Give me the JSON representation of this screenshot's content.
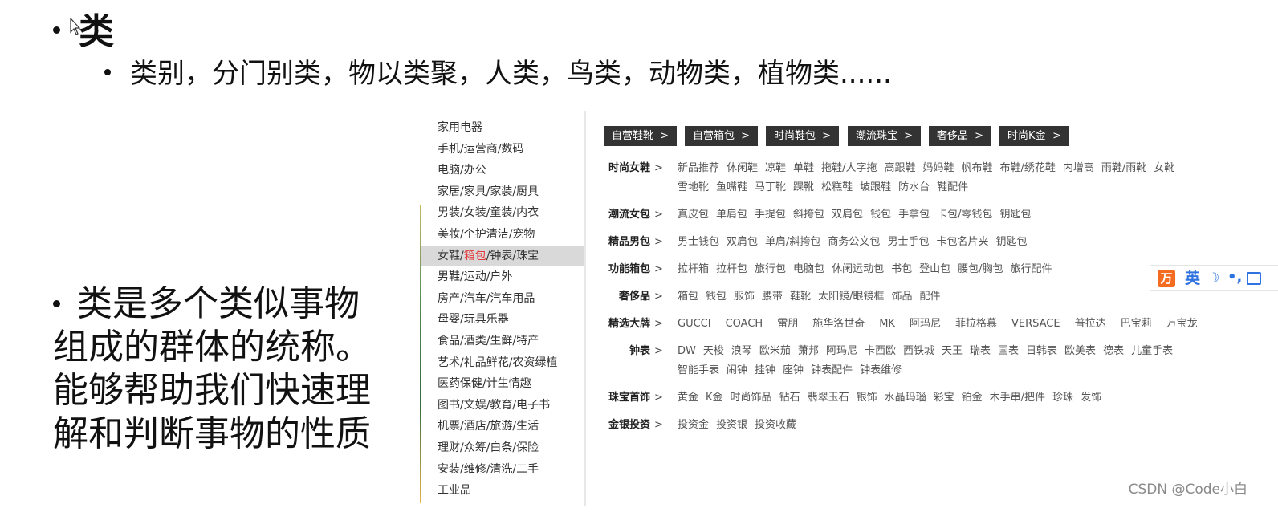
{
  "slide": {
    "title": "类",
    "subtitle": "类别，分门别类，物以类聚，人类，鸟类，动物类，植物类......",
    "definition_lines": [
      "类是多个类似事物",
      "组成的群体的统称。",
      "能够帮助我们快速理",
      "解和判断事物的性质"
    ]
  },
  "sidebar": {
    "items": [
      {
        "label": "家用电器"
      },
      {
        "label": "手机/运营商/数码"
      },
      {
        "label": "电脑/办公"
      },
      {
        "label": "家居/家具/家装/厨具"
      },
      {
        "label": "男装/女装/童装/内衣"
      },
      {
        "label": "美妆/个护清洁/宠物"
      },
      {
        "label_pre": "女鞋/",
        "label_hl": "箱包",
        "label_post": "/钟表/珠宝",
        "active": true
      },
      {
        "label": "男鞋/运动/户外"
      },
      {
        "label": "房产/汽车/汽车用品"
      },
      {
        "label": "母婴/玩具乐器"
      },
      {
        "label": "食品/酒类/生鲜/特产"
      },
      {
        "label": "艺术/礼品鲜花/农资绿植"
      },
      {
        "label": "医药保健/计生情趣"
      },
      {
        "label": "图书/文娱/教育/电子书"
      },
      {
        "label": "机票/酒店/旅游/生活"
      },
      {
        "label": "理财/众筹/白条/保险"
      },
      {
        "label": "安装/维修/清洗/二手"
      },
      {
        "label": "工业品"
      }
    ],
    "highlight_color": "#e4393c"
  },
  "tags": [
    {
      "label": "自营鞋靴"
    },
    {
      "label": "自营箱包"
    },
    {
      "label": "时尚鞋包"
    },
    {
      "label": "潮流珠宝"
    },
    {
      "label": "奢侈品"
    },
    {
      "label": "时尚K金"
    }
  ],
  "chevron": ">",
  "categories": [
    {
      "name": "时尚女鞋",
      "rows": [
        [
          "新品推荐",
          "休闲鞋",
          "凉鞋",
          "单鞋",
          "拖鞋/人字拖",
          "高跟鞋",
          "妈妈鞋",
          "帆布鞋",
          "布鞋/绣花鞋",
          "内增高",
          "雨鞋/雨靴",
          "女靴"
        ],
        [
          "雪地靴",
          "鱼嘴鞋",
          "马丁靴",
          "踝靴",
          "松糕鞋",
          "坡跟鞋",
          "防水台",
          "鞋配件"
        ]
      ]
    },
    {
      "name": "潮流女包",
      "rows": [
        [
          "真皮包",
          "单肩包",
          "手提包",
          "斜挎包",
          "双肩包",
          "钱包",
          "手拿包",
          "卡包/零钱包",
          "钥匙包"
        ]
      ]
    },
    {
      "name": "精品男包",
      "rows": [
        [
          "男士钱包",
          "双肩包",
          "单肩/斜挎包",
          "商务公文包",
          "男士手包",
          "卡包名片夹",
          "钥匙包"
        ]
      ]
    },
    {
      "name": "功能箱包",
      "rows": [
        [
          "拉杆箱",
          "拉杆包",
          "旅行包",
          "电脑包",
          "休闲运动包",
          "书包",
          "登山包",
          "腰包/胸包",
          "旅行配件"
        ]
      ]
    },
    {
      "name": "奢侈品",
      "rows": [
        [
          "箱包",
          "钱包",
          "服饰",
          "腰带",
          "鞋靴",
          "太阳镜/眼镜框",
          "饰品",
          "配件"
        ]
      ]
    },
    {
      "name": "精选大牌",
      "wide": true,
      "rows": [
        [
          "GUCCI",
          "COACH",
          "雷朋",
          "施华洛世奇",
          "MK",
          "阿玛尼",
          "菲拉格慕",
          "VERSACE",
          "普拉达",
          "巴宝莉",
          "万宝龙"
        ]
      ]
    },
    {
      "name": "钟表",
      "rows": [
        [
          "DW",
          "天梭",
          "浪琴",
          "欧米茄",
          "萧邦",
          "阿玛尼",
          "卡西欧",
          "西铁城",
          "天王",
          "瑞表",
          "国表",
          "日韩表",
          "欧美表",
          "德表",
          "儿童手表"
        ],
        [
          "智能手表",
          "闹钟",
          "挂钟",
          "座钟",
          "钟表配件",
          "钟表维修"
        ]
      ]
    },
    {
      "name": "珠宝首饰",
      "rows": [
        [
          "黄金",
          "K金",
          "时尚饰品",
          "钻石",
          "翡翠玉石",
          "银饰",
          "水晶玛瑙",
          "彩宝",
          "铂金",
          "木手串/把件",
          "珍珠",
          "发饰"
        ]
      ]
    },
    {
      "name": "金银投资",
      "rows": [
        [
          "投资金",
          "投资银",
          "投资收藏"
        ]
      ]
    }
  ],
  "ime": {
    "logo": "万",
    "lang": "英",
    "moon": "☽",
    "punct": "•,"
  },
  "watermark": "CSDN @Code小白"
}
